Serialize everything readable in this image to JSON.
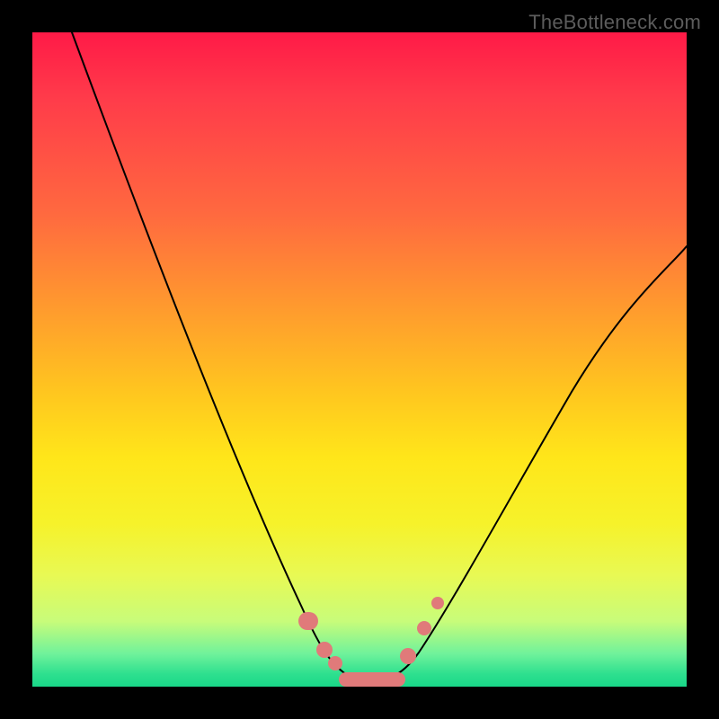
{
  "watermark": "TheBottleneck.com",
  "colors": {
    "frame": "#000000",
    "gradient_top": "#ff1a47",
    "gradient_bottom": "#19d788",
    "curve": "#000000",
    "marker": "#e07a7a"
  },
  "chart_data": {
    "type": "line",
    "title": "",
    "xlabel": "",
    "ylabel": "",
    "xlim": [
      0,
      100
    ],
    "ylim": [
      0,
      100
    ],
    "note": "Axes are untitled and unlabelled in the source image; x/y are normalized 0–100. y=100 at top (red / high bottleneck), y≈0 at bottom (green / balanced). Values estimated from pixel positions.",
    "series": [
      {
        "name": "bottleneck-curve",
        "x": [
          6,
          10,
          15,
          20,
          25,
          30,
          35,
          40,
          43,
          46,
          49,
          52,
          55,
          60,
          65,
          70,
          78,
          88,
          100
        ],
        "y": [
          100,
          90,
          78,
          66,
          53,
          40,
          28,
          16,
          8,
          3,
          1,
          1,
          3,
          10,
          21,
          32,
          45,
          57,
          68
        ]
      }
    ],
    "markers": [
      {
        "shape": "pill",
        "x_center": 42.0,
        "y": 9.5,
        "width": 3.0
      },
      {
        "shape": "circle",
        "x_center": 44.5,
        "y": 4.5,
        "r": 1.3
      },
      {
        "shape": "circle",
        "x_center": 46.0,
        "y": 2.5,
        "r": 1.2
      },
      {
        "shape": "pill",
        "x_center": 51.0,
        "y": 0.8,
        "width": 8.5
      },
      {
        "shape": "circle",
        "x_center": 57.0,
        "y": 4.2,
        "r": 1.3
      },
      {
        "shape": "circle",
        "x_center": 59.5,
        "y": 8.5,
        "r": 1.2
      },
      {
        "shape": "circle",
        "x_center": 61.5,
        "y": 12.5,
        "r": 1.1
      }
    ]
  }
}
